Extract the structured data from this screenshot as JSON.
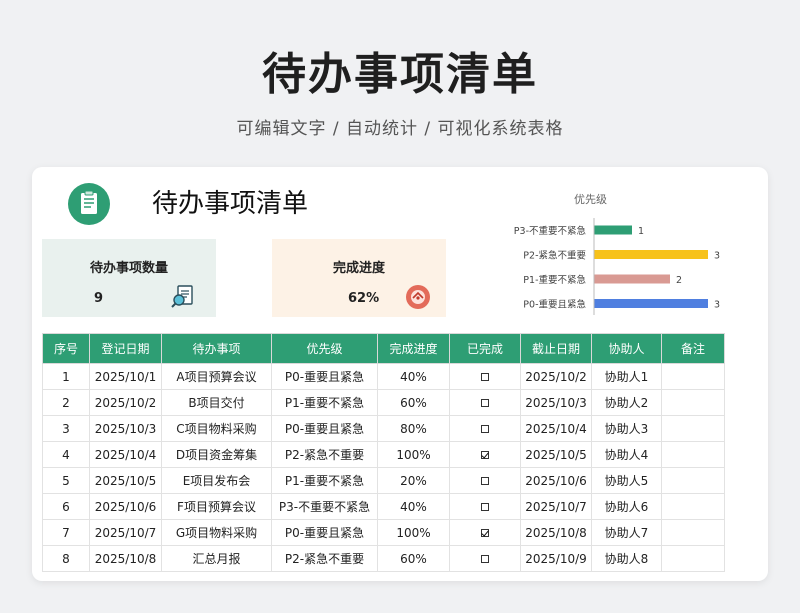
{
  "hero": {
    "title": "待办事项清单",
    "subtitle": "可编辑文字 / 自动统计 / 可视化系统表格"
  },
  "sheet": {
    "title": "待办事项清单",
    "summary": {
      "count_label": "待办事项数量",
      "count_value": "9",
      "progress_label": "完成进度",
      "progress_value": "62%",
      "count_icon": "document-magnifier-icon",
      "progress_icon": "gauge-icon"
    },
    "colors": {
      "header_green": "#2e9e74",
      "summary_green_bg": "#e9f1ee",
      "summary_orange_bg": "#fdf2e6"
    }
  },
  "chart_data": {
    "type": "bar",
    "orientation": "horizontal",
    "title": "优先级",
    "categories": [
      "P3-不重要不紧急",
      "P2-紧急不重要",
      "P1-重要不紧急",
      "P0-重要且紧急"
    ],
    "values": [
      1,
      3,
      2,
      3
    ],
    "colors": [
      "#2e9e74",
      "#f7c21b",
      "#d99a93",
      "#4f7fe0"
    ],
    "xlim": [
      0,
      3
    ],
    "grid": false,
    "legend": "none"
  },
  "table": {
    "headers": [
      "序号",
      "登记日期",
      "待办事项",
      "优先级",
      "完成进度",
      "已完成",
      "截止日期",
      "协助人",
      "备注"
    ],
    "rows": [
      {
        "no": "1",
        "date": "2025/10/1",
        "task": "A项目预算会议",
        "priority": "P0-重要且紧急",
        "progress": "40%",
        "done": false,
        "due": "2025/10/2",
        "helper": "协助人1",
        "note": ""
      },
      {
        "no": "2",
        "date": "2025/10/2",
        "task": "B项目交付",
        "priority": "P1-重要不紧急",
        "progress": "60%",
        "done": false,
        "due": "2025/10/3",
        "helper": "协助人2",
        "note": ""
      },
      {
        "no": "3",
        "date": "2025/10/3",
        "task": "C项目物料采购",
        "priority": "P0-重要且紧急",
        "progress": "80%",
        "done": false,
        "due": "2025/10/4",
        "helper": "协助人3",
        "note": ""
      },
      {
        "no": "4",
        "date": "2025/10/4",
        "task": "D项目资金筹集",
        "priority": "P2-紧急不重要",
        "progress": "100%",
        "done": true,
        "due": "2025/10/5",
        "helper": "协助人4",
        "note": ""
      },
      {
        "no": "5",
        "date": "2025/10/5",
        "task": "E项目发布会",
        "priority": "P1-重要不紧急",
        "progress": "20%",
        "done": false,
        "due": "2025/10/6",
        "helper": "协助人5",
        "note": ""
      },
      {
        "no": "6",
        "date": "2025/10/6",
        "task": "F项目预算会议",
        "priority": "P3-不重要不紧急",
        "progress": "40%",
        "done": false,
        "due": "2025/10/7",
        "helper": "协助人6",
        "note": ""
      },
      {
        "no": "7",
        "date": "2025/10/7",
        "task": "G项目物料采购",
        "priority": "P0-重要且紧急",
        "progress": "100%",
        "done": true,
        "due": "2025/10/8",
        "helper": "协助人7",
        "note": ""
      },
      {
        "no": "8",
        "date": "2025/10/8",
        "task": "汇总月报",
        "priority": "P2-紧急不重要",
        "progress": "60%",
        "done": false,
        "due": "2025/10/9",
        "helper": "协助人8",
        "note": ""
      }
    ]
  }
}
